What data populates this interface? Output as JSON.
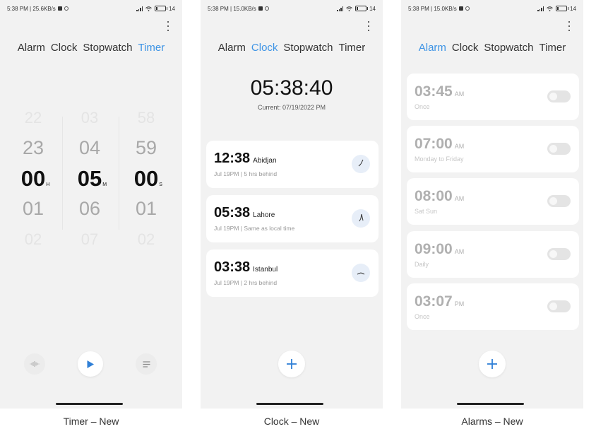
{
  "tabs": {
    "alarm": "Alarm",
    "clock": "Clock",
    "stopwatch": "Stopwatch",
    "timer": "Timer"
  },
  "accent": "#3e94e5",
  "timer_screen": {
    "status": {
      "time_speed": "5:38 PM | 25.6KB/s",
      "battery": "14"
    },
    "hours": {
      "rows": [
        "22",
        "23",
        "00",
        "01",
        "02"
      ],
      "unit": "H"
    },
    "minutes": {
      "rows": [
        "03",
        "04",
        "05",
        "06",
        "07"
      ],
      "unit": "M"
    },
    "seconds": {
      "rows": [
        "58",
        "59",
        "00",
        "01",
        "02"
      ],
      "unit": "S"
    },
    "caption": "Timer – New"
  },
  "clock_screen": {
    "status": {
      "time_speed": "5:38 PM | 15.0KB/s",
      "battery": "14"
    },
    "time": "05:38:40",
    "current": "Current: 07/19/2022 PM",
    "cities": [
      {
        "time": "12:38",
        "city": "Abidjan",
        "date": "Jul 19PM",
        "offset": "5 hrs behind"
      },
      {
        "time": "05:38",
        "city": "Lahore",
        "date": "Jul 19PM",
        "offset": "Same as local time"
      },
      {
        "time": "03:38",
        "city": "Istanbul",
        "date": "Jul 19PM",
        "offset": "2 hrs behind"
      }
    ],
    "caption": "Clock – New"
  },
  "alarms_screen": {
    "status": {
      "time_speed": "5:38 PM | 15.0KB/s",
      "battery": "14"
    },
    "alarms": [
      {
        "time": "03:45",
        "ampm": "AM",
        "repeat": "Once"
      },
      {
        "time": "07:00",
        "ampm": "AM",
        "repeat": "Monday to Friday"
      },
      {
        "time": "08:00",
        "ampm": "AM",
        "repeat": "Sat Sun"
      },
      {
        "time": "09:00",
        "ampm": "AM",
        "repeat": "Daily"
      },
      {
        "time": "03:07",
        "ampm": "PM",
        "repeat": "Once"
      }
    ],
    "caption": "Alarms – New"
  }
}
